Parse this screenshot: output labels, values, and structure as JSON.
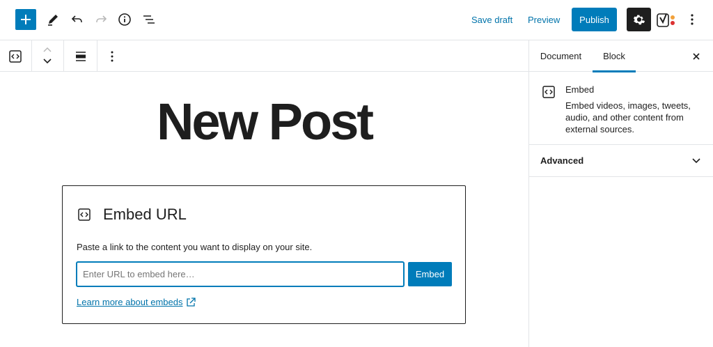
{
  "header": {
    "save_draft": "Save draft",
    "preview": "Preview",
    "publish": "Publish",
    "icons": [
      "plus-icon",
      "edit-pencil-icon",
      "undo-icon",
      "redo-icon",
      "info-icon",
      "list-view-icon",
      "gear-icon",
      "yoast-icon",
      "more-vertical-icon"
    ]
  },
  "block_toolbar": {
    "icons": [
      "embed-block-icon",
      "move-up-icon",
      "move-down-icon",
      "align-icon",
      "more-vertical-icon"
    ]
  },
  "post": {
    "title": "New Post"
  },
  "embed_block": {
    "title": "Embed URL",
    "instructions": "Paste a link to the content you want to display on your site.",
    "input_placeholder": "Enter URL to embed here…",
    "input_value": "",
    "button": "Embed",
    "learn_more": "Learn more about embeds"
  },
  "sidebar": {
    "tabs": [
      "Document",
      "Block"
    ],
    "active_tab": "Block",
    "block_card": {
      "title": "Embed",
      "description": "Embed videos, images, tweets, audio, and other content from external sources."
    },
    "panels": [
      "Advanced"
    ]
  },
  "colors": {
    "accent": "#007cba",
    "link": "#0073aa",
    "text": "#1e1e1e",
    "border": "#e2e4e7"
  }
}
